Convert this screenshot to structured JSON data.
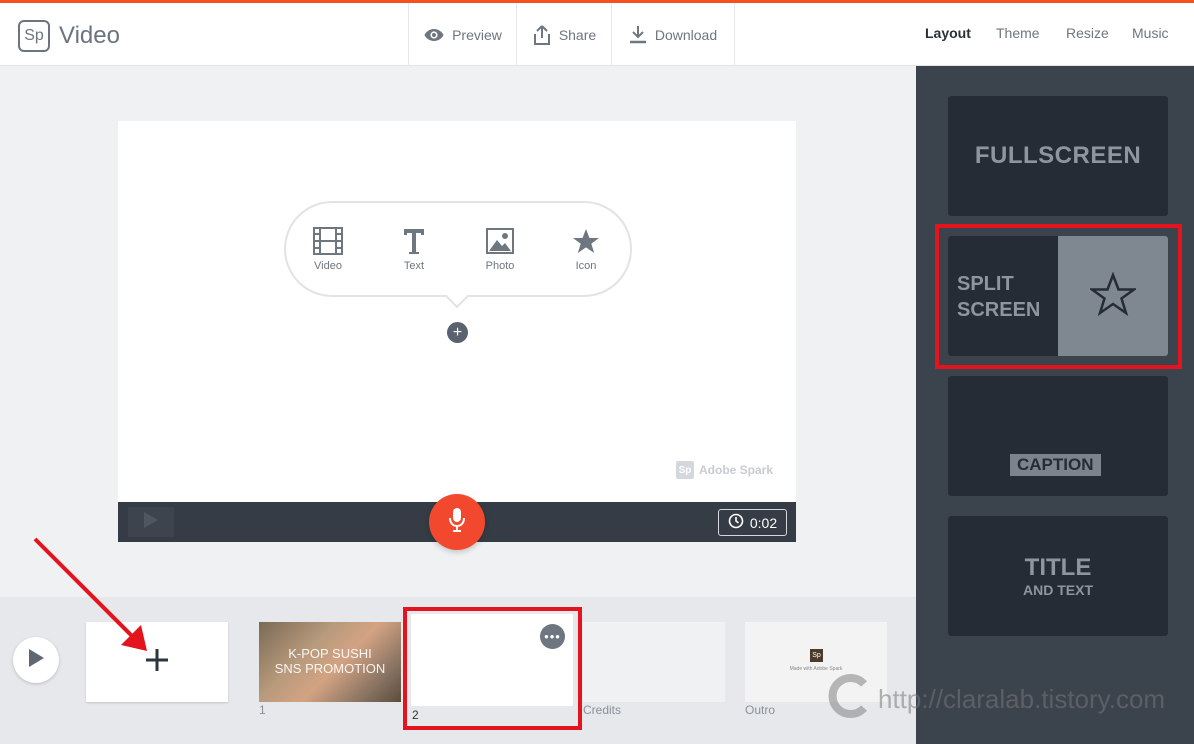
{
  "header": {
    "logo_text": "Sp",
    "app_title": "Video",
    "actions": {
      "preview": "Preview",
      "share": "Share",
      "download": "Download"
    },
    "right_tabs": [
      "Layout",
      "Theme",
      "Resize",
      "Music"
    ],
    "active_tab": "Layout"
  },
  "stage": {
    "add_options": [
      "Video",
      "Text",
      "Photo",
      "Icon"
    ],
    "watermark_logo": "Sp",
    "watermark_text": "Adobe Spark",
    "duration": "0:02"
  },
  "timeline": {
    "slides": [
      {
        "label": "1",
        "title": "K-POP SUSHI\nSNS PROMOTION"
      },
      {
        "label": "2"
      },
      {
        "label": "Credits"
      },
      {
        "label": "Outro",
        "badge": "Sp",
        "made_with": "Made with Adobe Spark"
      }
    ]
  },
  "layouts": {
    "fullscreen": "FULLSCREEN",
    "split_line1": "SPLIT",
    "split_line2": "SCREEN",
    "caption": "CAPTION",
    "title_main": "TITLE",
    "title_sub": "AND TEXT"
  },
  "blog_watermark": "http://claralab.tistory.com",
  "colors": {
    "accent": "#f4511e",
    "mic": "#f2492e",
    "highlight": "#e3141d",
    "panel": "#3b434d",
    "card": "#252c35"
  }
}
